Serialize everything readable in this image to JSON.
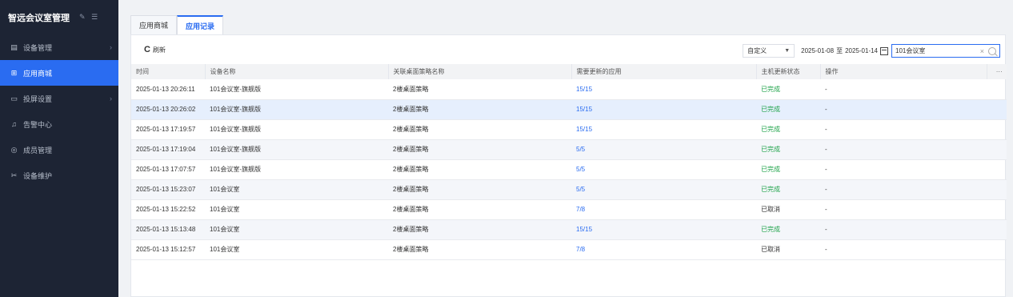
{
  "sidebar": {
    "title": "智远会议室管理",
    "items": [
      {
        "label": "设备管理",
        "icon": "device-icon",
        "chevron": true,
        "active": false
      },
      {
        "label": "应用商城",
        "icon": "grid-icon",
        "chevron": false,
        "active": true
      },
      {
        "label": "投屏设置",
        "icon": "screen-icon",
        "chevron": true,
        "active": false
      },
      {
        "label": "告警中心",
        "icon": "bell-icon",
        "chevron": false,
        "active": false
      },
      {
        "label": "成员管理",
        "icon": "user-icon",
        "chevron": false,
        "active": false
      },
      {
        "label": "设备维护",
        "icon": "wrench-icon",
        "chevron": false,
        "active": false
      }
    ]
  },
  "tabs": [
    {
      "label": "应用商城",
      "active": false
    },
    {
      "label": "应用记录",
      "active": true
    }
  ],
  "toolbar": {
    "refresh_label": "刷新",
    "range_select": "自定义",
    "date_start": "2025-01-08",
    "date_sep": "至",
    "date_end": "2025-01-14",
    "search_value": "101会议室"
  },
  "table": {
    "columns": [
      "时间",
      "设备名称",
      "关联桌面策略名称",
      "需要更新的应用",
      "主机更新状态",
      "操作"
    ],
    "more_label": "···",
    "rows": [
      {
        "time": "2025-01-13 20:26:11",
        "device": "101会议室-旗舰版",
        "policy": "2楼桌面策略",
        "apps": "15/15",
        "status": "已完成",
        "action": "-"
      },
      {
        "time": "2025-01-13 20:26:02",
        "device": "101会议室-旗舰版",
        "policy": "2楼桌面策略",
        "apps": "15/15",
        "status": "已完成",
        "action": "-"
      },
      {
        "time": "2025-01-13 17:19:57",
        "device": "101会议室-旗舰版",
        "policy": "2楼桌面策略",
        "apps": "15/15",
        "status": "已完成",
        "action": "-"
      },
      {
        "time": "2025-01-13 17:19:04",
        "device": "101会议室-旗舰版",
        "policy": "2楼桌面策略",
        "apps": "5/5",
        "status": "已完成",
        "action": "-"
      },
      {
        "time": "2025-01-13 17:07:57",
        "device": "101会议室-旗舰版",
        "policy": "2楼桌面策略",
        "apps": "5/5",
        "status": "已完成",
        "action": "-"
      },
      {
        "time": "2025-01-13 15:23:07",
        "device": "101会议室",
        "policy": "2楼桌面策略",
        "apps": "5/5",
        "status": "已完成",
        "action": "-"
      },
      {
        "time": "2025-01-13 15:22:52",
        "device": "101会议室",
        "policy": "2楼桌面策略",
        "apps": "7/8",
        "status": "已取消",
        "action": "-"
      },
      {
        "time": "2025-01-13 15:13:48",
        "device": "101会议室",
        "policy": "2楼桌面策略",
        "apps": "15/15",
        "status": "已完成",
        "action": "-"
      },
      {
        "time": "2025-01-13 15:12:57",
        "device": "101会议室",
        "policy": "2楼桌面策略",
        "apps": "7/8",
        "status": "已取消",
        "action": "-"
      }
    ]
  },
  "colors": {
    "accent": "#2a6cf1",
    "sidebar_bg": "#1d2434",
    "status_done": "#1fa34a"
  }
}
